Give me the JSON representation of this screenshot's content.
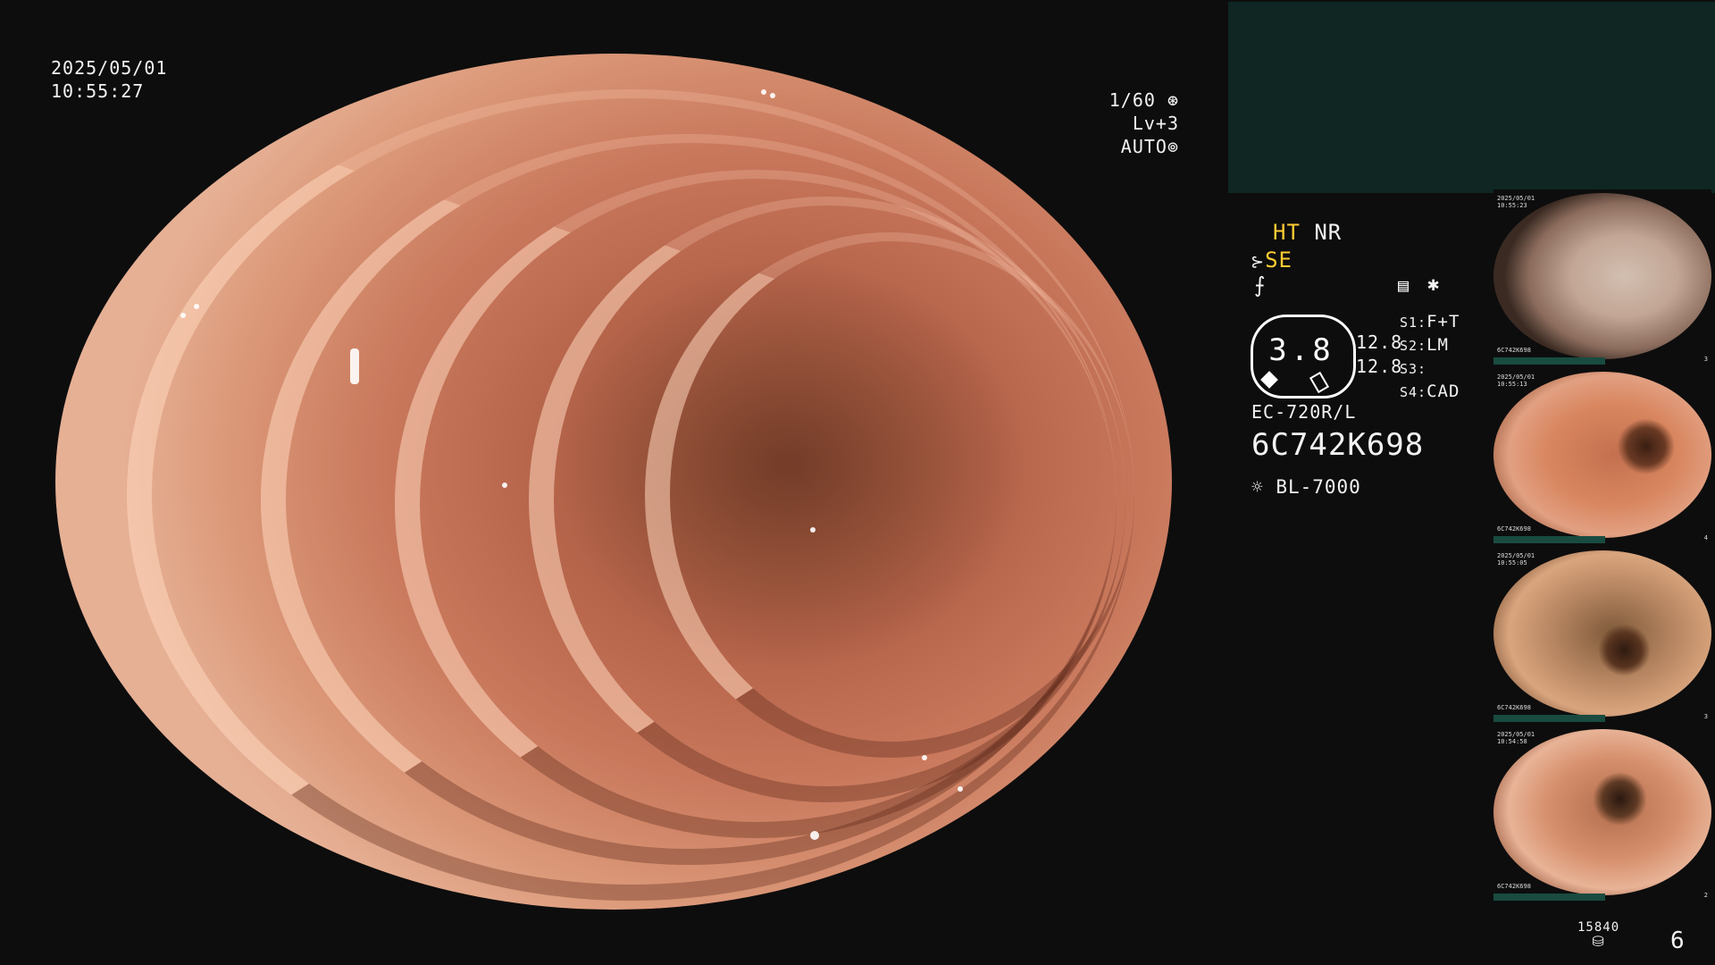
{
  "overlay": {
    "date": "2025/05/01",
    "time": "10:55:27",
    "shutter": "1/60",
    "level": "Lv+3",
    "mode": "AUTO"
  },
  "settings": {
    "ht": "HT",
    "nr": "NR",
    "se": "SE",
    "zoom": "3.8",
    "value_1": "12.8",
    "value_2": "12.8",
    "s1_label": "S1:",
    "s1_value": "F+T",
    "s2_label": "S2:",
    "s2_value": "LM",
    "s3_label": "S3:",
    "s3_value": "",
    "s4_label": "S4:",
    "s4_value": "CAD",
    "scope_model": "EC-720R/L",
    "serial": "6C742K698",
    "light_source": "BL-7000"
  },
  "footer": {
    "storage_count": "15840",
    "image_count": "6"
  },
  "thumbnails": [
    {
      "date": "2025/05/01",
      "time": "10:55:23",
      "serial": "6C742K698",
      "index": "3"
    },
    {
      "date": "2025/05/01",
      "time": "10:55:13",
      "serial": "6C742K698",
      "index": "4"
    },
    {
      "date": "2025/05/01",
      "time": "10:55:05",
      "serial": "6C742K698",
      "index": "3"
    },
    {
      "date": "2025/05/01",
      "time": "10:54:58",
      "serial": "6C742K698",
      "index": "2"
    }
  ],
  "colors": {
    "panel": "#0f2623",
    "highlight_text": "#ffcc33",
    "background": "#0d0d0d"
  }
}
